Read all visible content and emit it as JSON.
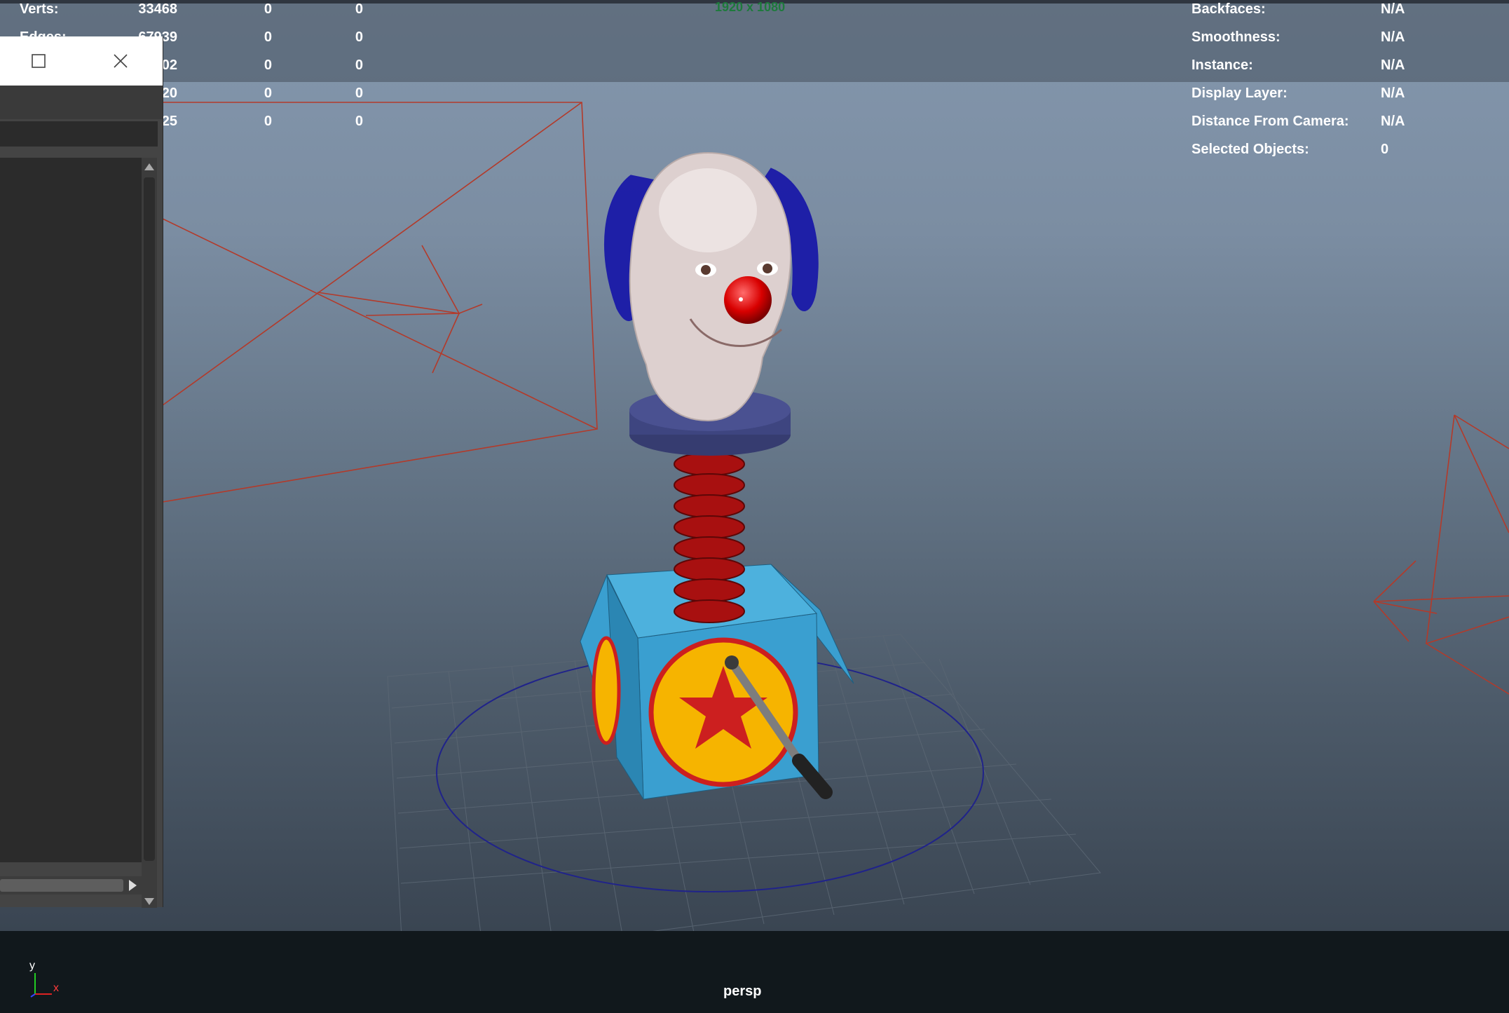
{
  "viewport": {
    "camera_label": "persp",
    "resolution_gate": "1920 x 1080"
  },
  "hud_left": {
    "rows": [
      {
        "label": "Verts:",
        "v1": "33468",
        "v2": "0",
        "v3": "0"
      },
      {
        "label": "Edges:",
        "v1": "67939",
        "v2": "0",
        "v3": "0"
      },
      {
        "label": "",
        "v1": "02",
        "v2": "0",
        "v3": "0"
      },
      {
        "label": "",
        "v1": "20",
        "v2": "0",
        "v3": "0"
      },
      {
        "label": "",
        "v1": "25",
        "v2": "0",
        "v3": "0"
      }
    ]
  },
  "hud_right": {
    "rows": [
      {
        "label": "Backfaces:",
        "value": "N/A"
      },
      {
        "label": "Smoothness:",
        "value": "N/A"
      },
      {
        "label": "Instance:",
        "value": "N/A"
      },
      {
        "label": "Display Layer:",
        "value": "N/A"
      },
      {
        "label": "Distance From Camera:",
        "value": "N/A"
      },
      {
        "label": "Selected Objects:",
        "value": "0"
      }
    ]
  },
  "window": {
    "maximize_icon": "maximize-icon",
    "close_icon": "close-icon"
  },
  "axis": {
    "y_label": "y",
    "x_label": "x"
  },
  "colors": {
    "camera_wire": "#b33a2a",
    "ground_circle": "#20238a",
    "box": "#3a9fd0",
    "star_disc": "#f6b400",
    "star": "#cc1f1f",
    "nose": "#d80000",
    "hair": "#1a1aa8"
  }
}
